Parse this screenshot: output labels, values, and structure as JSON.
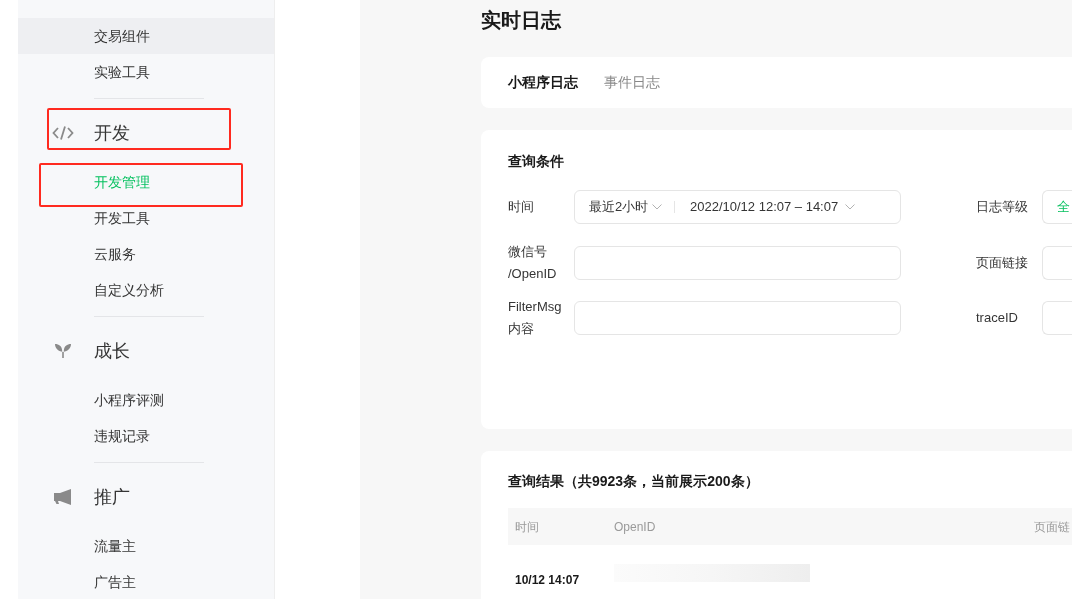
{
  "sidebar": {
    "items": [
      {
        "label": "交易组件",
        "hovered": true,
        "selected": false,
        "highlighted": false
      },
      {
        "label": "实验工具",
        "hovered": false,
        "selected": false,
        "highlighted": false
      }
    ],
    "sections": [
      {
        "kind": "code",
        "title": "开发",
        "highlighted": true,
        "items": [
          {
            "label": "开发管理",
            "hovered": false,
            "selected": true,
            "highlighted": true
          },
          {
            "label": "开发工具",
            "hovered": false,
            "selected": false,
            "highlighted": false
          },
          {
            "label": "云服务",
            "hovered": false,
            "selected": false,
            "highlighted": false
          },
          {
            "label": "自定义分析",
            "hovered": false,
            "selected": false,
            "highlighted": false
          }
        ]
      },
      {
        "kind": "sprout",
        "title": "成长",
        "highlighted": false,
        "items": [
          {
            "label": "小程序评测",
            "hovered": false,
            "selected": false,
            "highlighted": false
          },
          {
            "label": "违规记录",
            "hovered": false,
            "selected": false,
            "highlighted": false
          }
        ]
      },
      {
        "kind": "megaphone",
        "title": "推广",
        "highlighted": false,
        "items": [
          {
            "label": "流量主",
            "hovered": false,
            "selected": false,
            "highlighted": false
          },
          {
            "label": "广告主",
            "hovered": false,
            "selected": false,
            "highlighted": false
          }
        ]
      }
    ]
  },
  "page_title": "实时日志",
  "tabs": [
    {
      "label": "小程序日志",
      "selected": true
    },
    {
      "label": "事件日志",
      "selected": false
    }
  ],
  "query": {
    "title": "查询条件",
    "time": {
      "label": "时间",
      "range": "最近2小时",
      "value": "2022/10/12 12:07 – 14:07"
    },
    "log_level": {
      "label": "日志等级",
      "value": "全"
    },
    "wechat_id": {
      "label": "微信号\n/OpenID"
    },
    "page_link": {
      "label": "页面链接"
    },
    "filter_msg": {
      "label": "FilterMsg\n内容"
    },
    "trace_id": {
      "label": "traceID"
    }
  },
  "results": {
    "title": "查询结果（共9923条，当前展示200条）",
    "columns": [
      "时间",
      "OpenID",
      "页面链"
    ],
    "rows": [
      {
        "time": "10/12 14:07",
        "openid_redacted": true
      }
    ]
  }
}
